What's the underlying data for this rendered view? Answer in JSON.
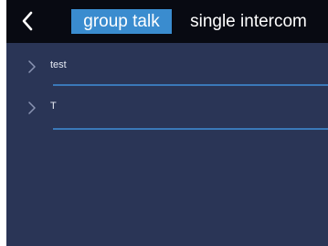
{
  "header": {
    "back_icon": "chevron-left-icon",
    "tabs": [
      {
        "label": "group talk",
        "active": true
      },
      {
        "label": "single intercom",
        "active": false
      }
    ]
  },
  "list": {
    "items": [
      {
        "label": "test",
        "icon": "chevron-right-icon"
      },
      {
        "label": "T",
        "icon": "chevron-right-icon"
      }
    ]
  },
  "colors": {
    "background": "#2a3556",
    "topbar": "#080a12",
    "active_tab": "#3a8ccf",
    "divider": "#3a78b8",
    "text": "#ffffff"
  }
}
